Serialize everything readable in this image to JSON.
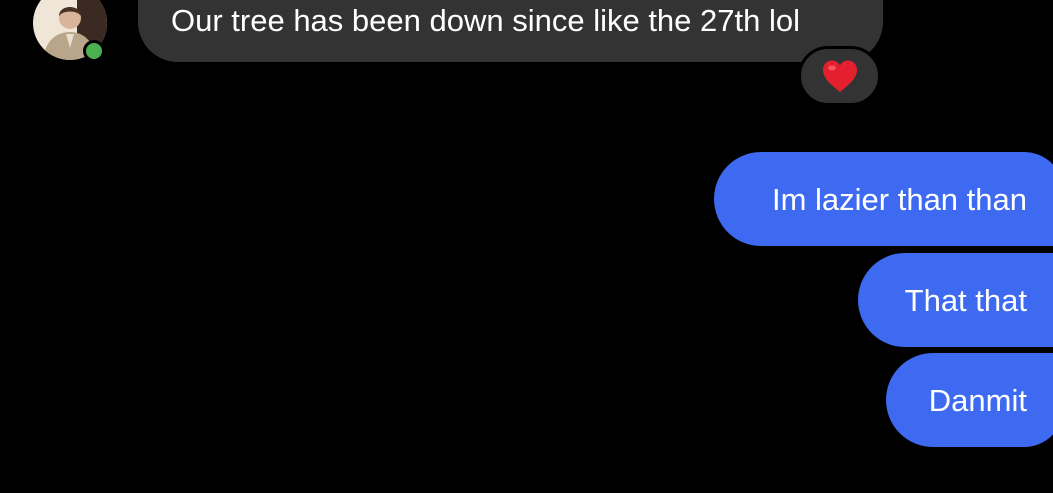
{
  "conversation": {
    "incoming": {
      "message": "Our tree has been down since like the 27th lol",
      "reaction_icon": "heart-icon",
      "reaction_color": "#e5202e",
      "bubble_color": "#333333",
      "presence_status": "online",
      "presence_color": "#4caf50"
    },
    "outgoing": {
      "bubble_color": "#3d6af1",
      "messages": [
        "Im lazier than than",
        "That that",
        "Danmit"
      ]
    }
  }
}
